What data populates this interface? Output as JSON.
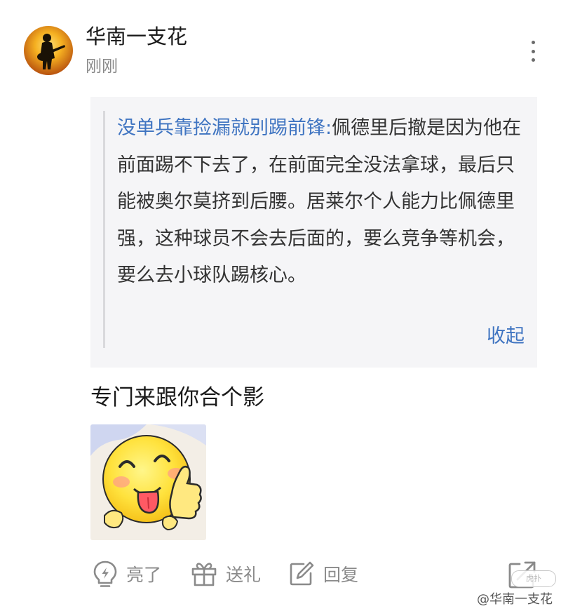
{
  "post": {
    "username": "华南一支花",
    "timestamp": "刚刚"
  },
  "quote": {
    "author": "没单兵靠捡漏就别踢前锋:",
    "content": "佩德里后撤是因为他在前面踢不下去了，在前面完全没法拿球，最后只能被奥尔莫挤到后腰。居莱尔个人能力比佩德里强，这种球员不会去后面的，要么竞争等机会，要么去小球队踢核心。",
    "collapse_label": "收起"
  },
  "reply": {
    "text": "专门来跟你合个影"
  },
  "actions": {
    "like_label": "亮了",
    "gift_label": "送礼",
    "reply_label": "回复"
  },
  "watermark": {
    "badge": "虎扑",
    "text": "@华南一支花"
  },
  "icons": {
    "more": "more-vertical-icon",
    "like": "lightbulb-icon",
    "gift": "gift-icon",
    "reply": "edit-icon",
    "share": "share-icon"
  },
  "colors": {
    "link_blue": "#3f74c1",
    "quote_bg": "#f5f5f7",
    "muted_text": "#8a8a8a"
  }
}
